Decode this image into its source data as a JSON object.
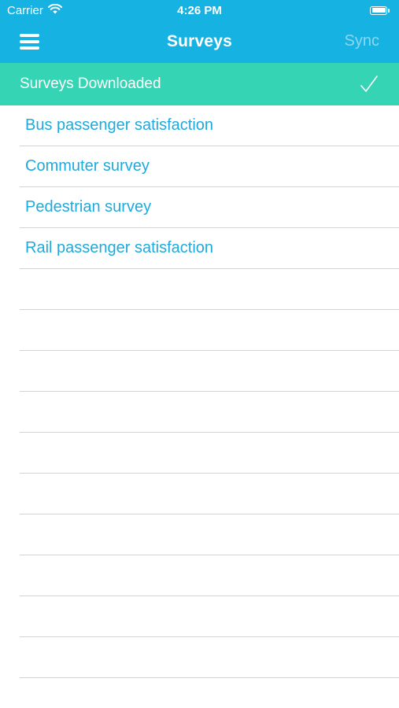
{
  "status_bar": {
    "carrier": "Carrier",
    "time": "4:26 PM",
    "wifi_icon": "wifi-icon",
    "battery_icon": "battery-icon"
  },
  "nav": {
    "menu_icon": "hamburger-menu-icon",
    "title": "Surveys",
    "sync_label": "Sync"
  },
  "banner": {
    "text": "Surveys Downloaded",
    "icon": "checkmark-icon"
  },
  "surveys": [
    {
      "label": "Bus passenger satisfaction"
    },
    {
      "label": "Commuter survey"
    },
    {
      "label": "Pedestrian survey"
    },
    {
      "label": "Rail passenger satisfaction"
    }
  ],
  "colors": {
    "nav_background": "#15b2e2",
    "banner_background": "#35d4b4",
    "link_text": "#1eaadc",
    "sync_disabled": "#8ed7ef",
    "separator": "#d3d3d3"
  }
}
